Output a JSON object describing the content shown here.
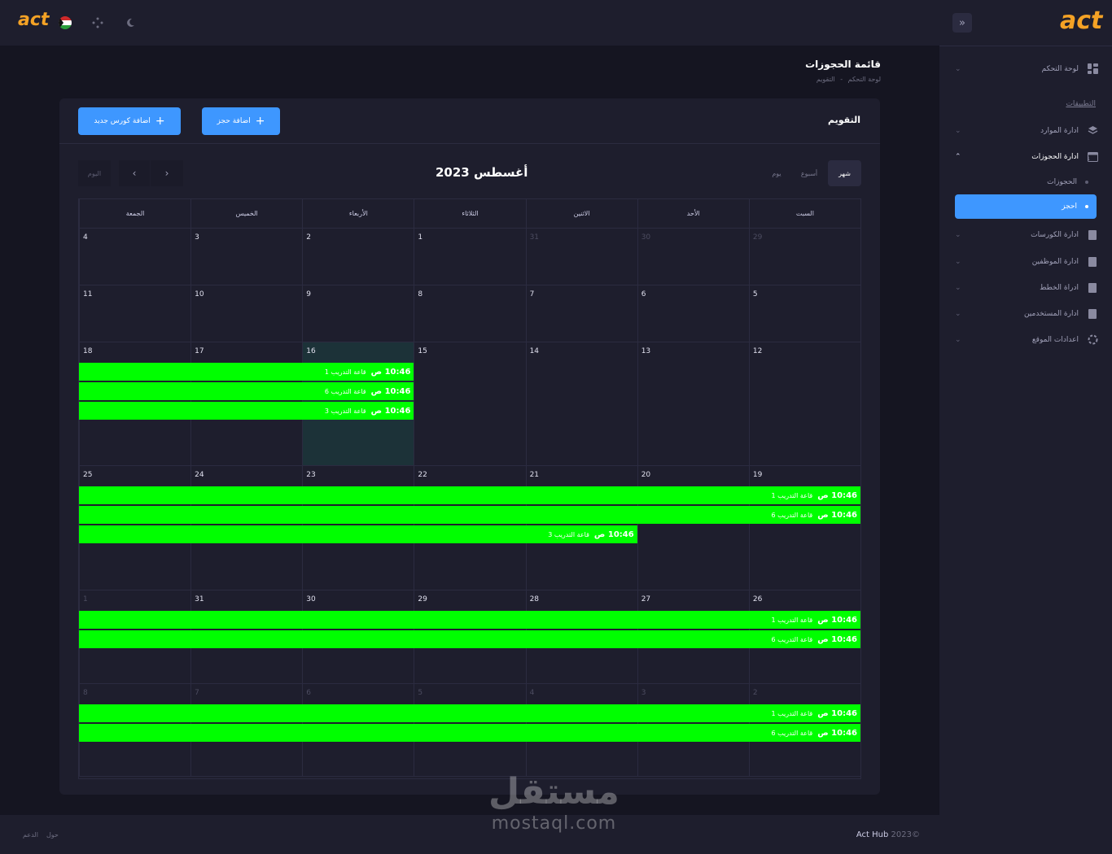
{
  "header": {
    "logo": "act",
    "brand_logo": "act",
    "icons": [
      "flag-icon",
      "dots-icon",
      "moon-icon"
    ],
    "collapse_icon": "double-chevron-right-icon"
  },
  "sidebar": {
    "items": [
      {
        "label": "لوحة التحكم",
        "icon": "dashboard-icon"
      },
      {
        "label": "ادارة الموارد",
        "icon": "layers-icon"
      },
      {
        "label": "ادارة الحجوزات",
        "icon": "calendar-icon"
      },
      {
        "label": "ادارة الكورسات",
        "icon": "document-icon"
      },
      {
        "label": "ادارة الموظفين",
        "icon": "document-icon"
      },
      {
        "label": "ادراة الخطط",
        "icon": "document-icon"
      },
      {
        "label": "ادارة المستخدمين",
        "icon": "document-icon"
      },
      {
        "label": "اعدادات الموقع",
        "icon": "loader-icon"
      }
    ],
    "section_label": "التطبيقات",
    "sub_items": [
      "الحجوزات",
      "احجز"
    ]
  },
  "page": {
    "title": "قائمة الحجوزات",
    "breadcrumb": [
      "لوحة التحكم",
      "-",
      "التقويم"
    ]
  },
  "card": {
    "title": "التقويم",
    "add_booking": "اضافة حجز",
    "add_course": "اضافة كورس جديد"
  },
  "calendar": {
    "views": [
      "شهر",
      "أسبوع",
      "يوم"
    ],
    "month_title": "أغسطس 2023",
    "today_label": "اليوم",
    "weekdays": [
      "السبت",
      "الأحد",
      "الاثنين",
      "الثلاثاء",
      "الأربعاء",
      "الخميس",
      "الجمعة"
    ],
    "weeks": [
      [
        "29",
        "30",
        "31",
        "1",
        "2",
        "3",
        "4"
      ],
      [
        "5",
        "6",
        "7",
        "8",
        "9",
        "10",
        "11"
      ],
      [
        "12",
        "13",
        "14",
        "15",
        "16",
        "17",
        "18"
      ],
      [
        "19",
        "20",
        "21",
        "22",
        "23",
        "24",
        "25"
      ],
      [
        "26",
        "27",
        "28",
        "29",
        "30",
        "31",
        "1"
      ],
      [
        "2",
        "3",
        "4",
        "5",
        "6",
        "7",
        "8"
      ]
    ],
    "event_time": "10:46 ص",
    "event_color": "#00ff00",
    "events": [
      {
        "week": 2,
        "from_col": 4,
        "to_col": 6,
        "title": "قاعة التدريب 1"
      },
      {
        "week": 2,
        "from_col": 4,
        "to_col": 6,
        "title": "قاعة التدريب 6"
      },
      {
        "week": 2,
        "from_col": 4,
        "to_col": 6,
        "title": "قاعة التدريب 3"
      },
      {
        "week": 3,
        "from_col": 0,
        "to_col": 6,
        "title": "قاعة التدريب 1"
      },
      {
        "week": 3,
        "from_col": 0,
        "to_col": 6,
        "title": "قاعة التدريب 6"
      },
      {
        "week": 3,
        "from_col": 2,
        "to_col": 6,
        "title": "قاعة التدريب 3"
      },
      {
        "week": 4,
        "from_col": 0,
        "to_col": 6,
        "title": "قاعة التدريب 1"
      },
      {
        "week": 4,
        "from_col": 0,
        "to_col": 6,
        "title": "قاعة التدريب 6"
      },
      {
        "week": 5,
        "from_col": 0,
        "to_col": 6,
        "title": "قاعة التدريب 1"
      },
      {
        "week": 5,
        "from_col": 0,
        "to_col": 6,
        "title": "قاعة التدريب 6"
      }
    ]
  },
  "footer": {
    "year": "2023©",
    "brand": "Act Hub",
    "links": [
      "الدعم",
      "حول"
    ]
  },
  "watermark": {
    "arabic": "مستقل",
    "latin": "mostaql.com"
  }
}
